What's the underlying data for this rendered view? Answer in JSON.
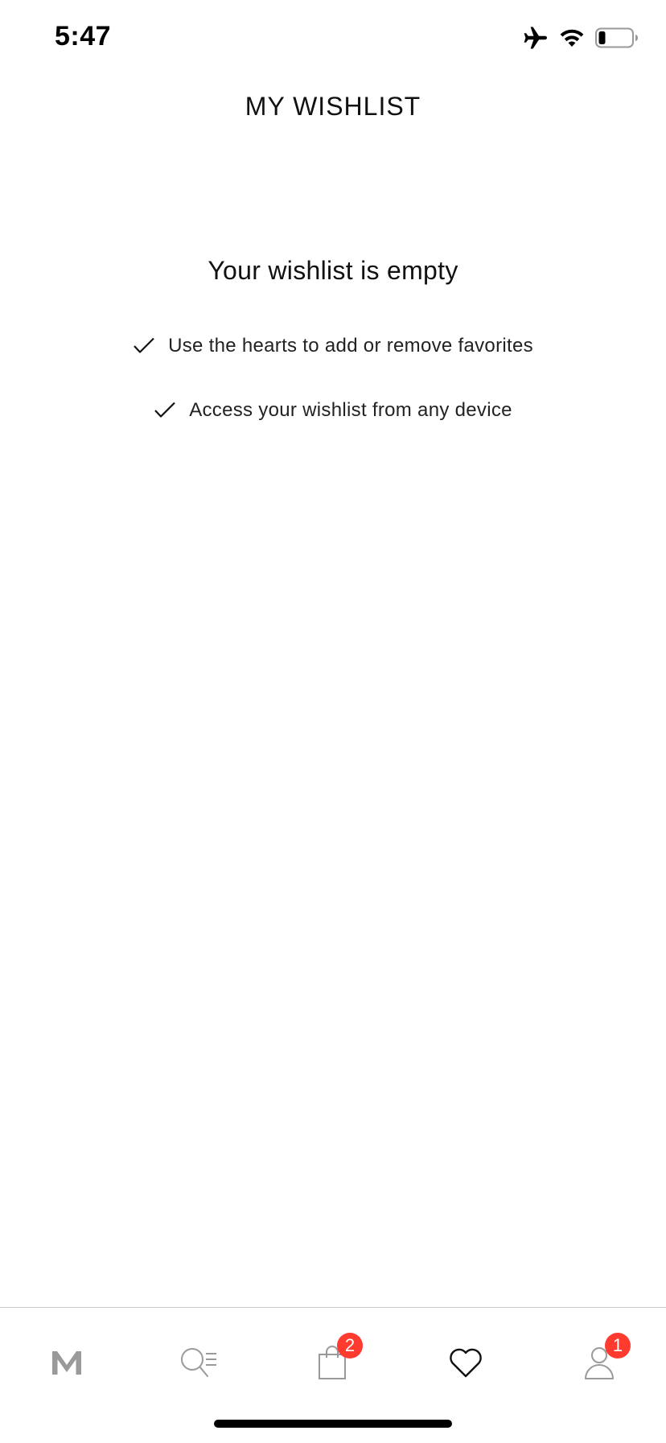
{
  "status_bar": {
    "time": "5:47",
    "icons": [
      "airplane-mode-icon",
      "wifi-icon",
      "battery-icon"
    ]
  },
  "header": {
    "title": "MY WISHLIST"
  },
  "empty_state": {
    "heading": "Your wishlist is empty",
    "benefits": [
      {
        "icon": "checkmark-icon",
        "text": "Use the hearts to add or remove favorites"
      },
      {
        "icon": "checkmark-icon",
        "text": "Access your wishlist from any device"
      }
    ]
  },
  "tab_bar": {
    "tabs": [
      {
        "icon": "brand-logo-icon",
        "active": false
      },
      {
        "icon": "search-menu-icon",
        "active": false
      },
      {
        "icon": "shopping-bag-icon",
        "active": false,
        "badge": "2"
      },
      {
        "icon": "heart-icon",
        "active": true
      },
      {
        "icon": "account-icon",
        "active": false,
        "badge": "1"
      }
    ]
  },
  "colors": {
    "text": "#111111",
    "inactive_icon": "#9a9a9a",
    "active_icon": "#111111",
    "badge": "#ff3b30",
    "divider": "#c8c8c8"
  }
}
